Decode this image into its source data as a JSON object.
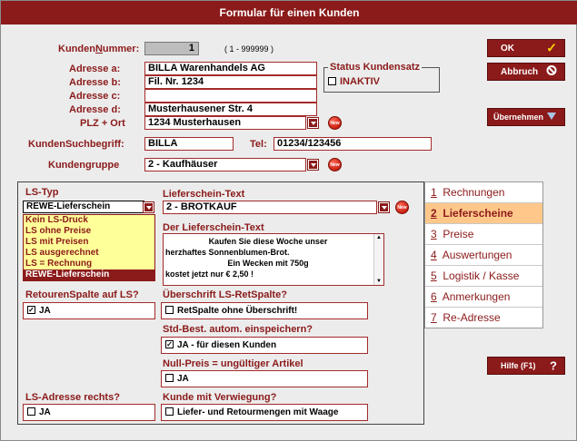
{
  "window": {
    "title": "Formular für einen Kunden"
  },
  "form": {
    "kundennummer_label_pre": "Kunden",
    "kundennummer_label_u": "N",
    "kundennummer_label_post": "ummer:",
    "kundennummer_value": "1",
    "kundennummer_range": "( 1 - 999999 )",
    "adresse_a_label": "Adresse a:",
    "adresse_a_value": "BILLA Warenhandels AG",
    "adresse_b_label": "Adresse b:",
    "adresse_b_value": "Fil. Nr. 1234",
    "adresse_c_label": "Adresse c:",
    "adresse_c_value": "",
    "adresse_d_label": "Adresse d:",
    "adresse_d_value": "Musterhausener Str. 4",
    "plz_label": "PLZ + Ort",
    "plz_value": "1234 Musterhausen",
    "suchbegriff_label": "KundenSuchbegriff:",
    "suchbegriff_value": "BILLA",
    "tel_label": "Tel:",
    "tel_value": "01234/123456",
    "kundengruppe_label": "Kundengruppe",
    "kundengruppe_value": "2 - Kaufhäuser",
    "status_title": "Status Kundensatz",
    "status_inaktiv": "INAKTIV",
    "new_icon_text": "New"
  },
  "buttons": {
    "ok": "OK",
    "abbruch": "Abbruch",
    "uebernehmen": "Übernehmen",
    "hilfe": "Hilfe (F1)"
  },
  "lieferscheine": {
    "ls_typ_label": "LS-Typ",
    "ls_typ_value": "REWE-Lieferschein",
    "ls_typ_options": [
      "Kein LS-Druck",
      "LS ohne Preise",
      "LS mit Preisen",
      "LS ausgerechnet",
      "LS = Rechnung",
      "REWE-Lieferschein"
    ],
    "lieferschein_text_label": "Lieferschein-Text",
    "lieferschein_text_value": "2 - BROTKAUF",
    "der_text_label": "Der Lieferschein-Text",
    "der_text_lines": [
      "Kaufen Sie diese Woche unser",
      "herzhaftes Sonnenblumen-Brot.",
      "Ein Wecken mit 750g",
      "kostet jetzt nur € 2,50 !"
    ],
    "retouren_label": "RetourenSpalte auf LS?",
    "retouren_value": "JA",
    "ueberschrift_label": "Überschrift LS-RetSpalte?",
    "ueberschrift_value": "RetSpalte ohne Überschrift!",
    "stdbest_label": "Std-Best. autom. einspeichern?",
    "stdbest_value": "JA - für diesen Kunden",
    "nullpreis_label": "Null-Preis = ungültiger Artikel",
    "nullpreis_value": "JA",
    "lsadresse_label": "LS-Adresse rechts?",
    "lsadresse_value": "JA",
    "verwiegung_label": "Kunde mit Verwiegung?",
    "verwiegung_value": "Liefer- und Retourmengen mit Waage"
  },
  "tabs": [
    {
      "num": "1",
      "label": "Rechnungen"
    },
    {
      "num": "2",
      "label": "Lieferscheine"
    },
    {
      "num": "3",
      "label": "Preise"
    },
    {
      "num": "4",
      "label": "Auswertungen"
    },
    {
      "num": "5",
      "label": "Logistik / Kasse"
    },
    {
      "num": "6",
      "label": "Anmerkungen"
    },
    {
      "num": "7",
      "label": "Re-Adresse"
    }
  ],
  "colors": {
    "accent": "#8b1a1a",
    "active_tab": "#ffc88a",
    "dropdown_bg": "#ffff99"
  }
}
